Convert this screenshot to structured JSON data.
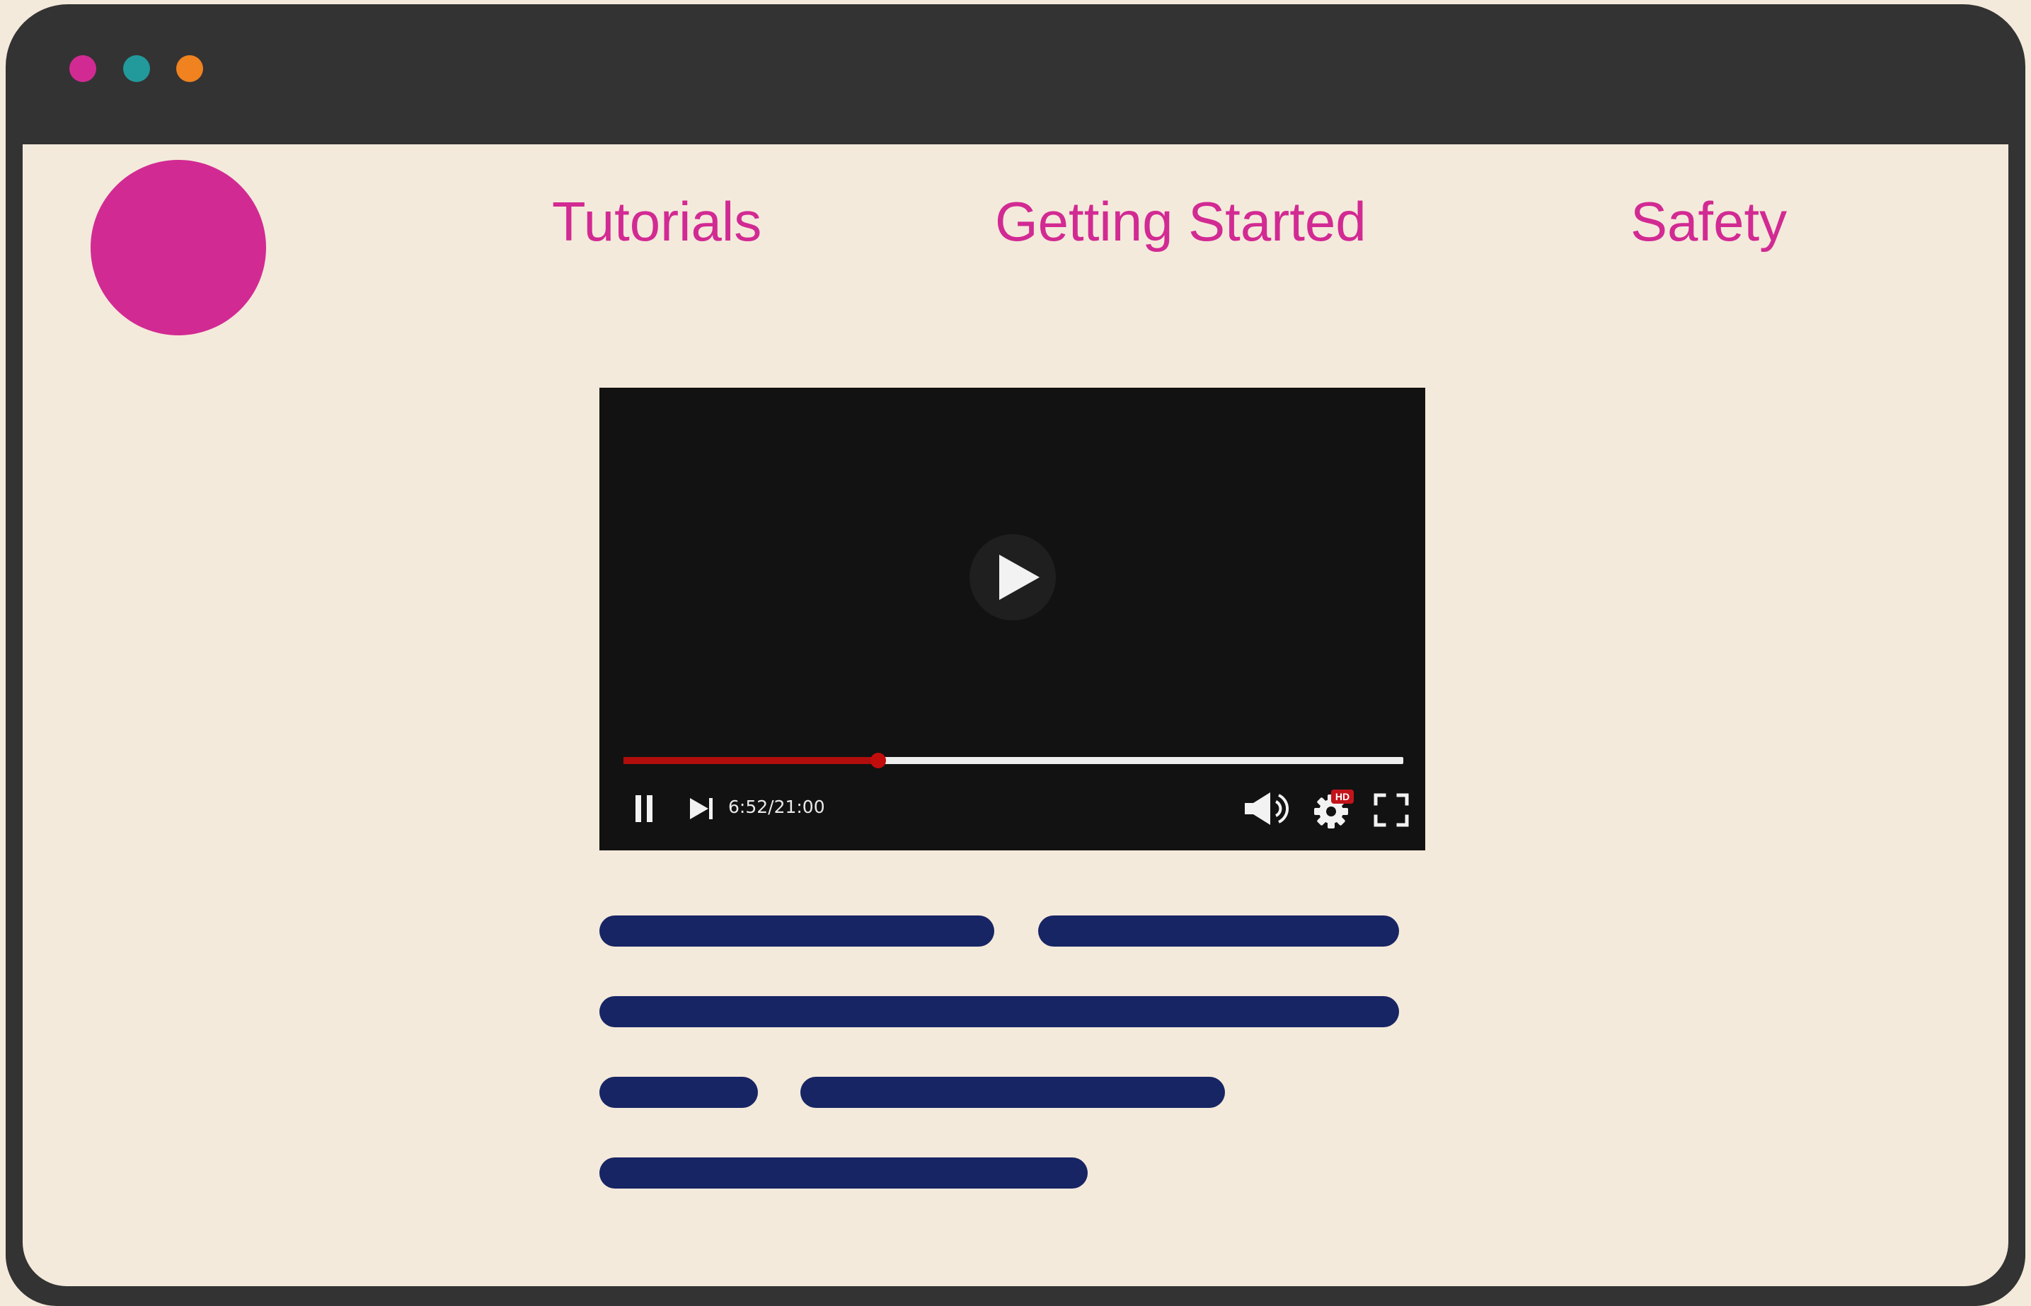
{
  "colors": {
    "window_frame": "#333333",
    "page_background": "#f4eadb",
    "accent_magenta": "#d22a93",
    "dot_teal": "#22999b",
    "dot_orange": "#f0821f",
    "text_placeholder": "#172564",
    "video_background": "#121212",
    "progress_played": "#b00d0d",
    "progress_remaining": "#eeeeee"
  },
  "window": {
    "controls": [
      {
        "name": "close",
        "color": "#d22a93"
      },
      {
        "name": "minimize",
        "color": "#22999b"
      },
      {
        "name": "maximize",
        "color": "#f0821f"
      }
    ]
  },
  "header": {
    "logo": {
      "icon": "circle-logo",
      "color": "#d22a93"
    },
    "nav": [
      {
        "label": "Tutorials"
      },
      {
        "label": "Getting Started"
      },
      {
        "label": "Safety"
      }
    ]
  },
  "video_player": {
    "big_play_icon": "play-icon",
    "progress_fraction": 0.327,
    "time_display": "6:52/21:00",
    "controls": {
      "pause_icon": "pause-icon",
      "next_icon": "skip-next-icon",
      "volume_icon": "volume-icon",
      "settings_icon": "gear-icon",
      "quality_badge": "HD",
      "fullscreen_icon": "fullscreen-icon"
    }
  },
  "placeholder_text_lines": {
    "count": 6,
    "color": "#172564"
  }
}
